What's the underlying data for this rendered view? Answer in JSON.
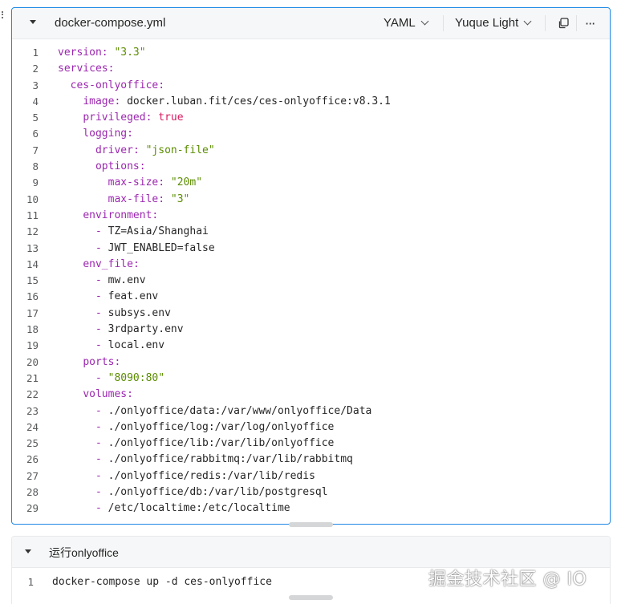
{
  "block1": {
    "filename": "docker-compose.yml",
    "language": "YAML",
    "theme": "Yuque Light",
    "copy_icon": "copy-icon",
    "more_icon": "more-icon",
    "lines": [
      {
        "n": "1",
        "indent": "",
        "key": "version",
        "sep": ": ",
        "val": "\"3.3\"",
        "vt": "s"
      },
      {
        "n": "2",
        "indent": "",
        "key": "services",
        "sep": ":",
        "val": "",
        "vt": ""
      },
      {
        "n": "3",
        "indent": "  ",
        "key": "ces-onlyoffice",
        "sep": ":",
        "val": "",
        "vt": ""
      },
      {
        "n": "4",
        "indent": "    ",
        "key": "image",
        "sep": ": ",
        "val": "docker.luban.fit/ces/ces-onlyoffice:v8.3.1",
        "vt": "p"
      },
      {
        "n": "5",
        "indent": "    ",
        "key": "privileged",
        "sep": ": ",
        "val": "true",
        "vt": "b"
      },
      {
        "n": "6",
        "indent": "    ",
        "key": "logging",
        "sep": ":",
        "val": "",
        "vt": ""
      },
      {
        "n": "7",
        "indent": "      ",
        "key": "driver",
        "sep": ": ",
        "val": "\"json-file\"",
        "vt": "s"
      },
      {
        "n": "8",
        "indent": "      ",
        "key": "options",
        "sep": ":",
        "val": "",
        "vt": ""
      },
      {
        "n": "9",
        "indent": "        ",
        "key": "max-size",
        "sep": ": ",
        "val": "\"20m\"",
        "vt": "s"
      },
      {
        "n": "10",
        "indent": "        ",
        "key": "max-file",
        "sep": ": ",
        "val": "\"3\"",
        "vt": "s"
      },
      {
        "n": "11",
        "indent": "    ",
        "key": "environment",
        "sep": ":",
        "val": "",
        "vt": ""
      },
      {
        "n": "12",
        "indent": "      ",
        "key": "",
        "sep": "- ",
        "val": "TZ=Asia/Shanghai",
        "vt": "p"
      },
      {
        "n": "13",
        "indent": "      ",
        "key": "",
        "sep": "- ",
        "val": "JWT_ENABLED=false",
        "vt": "p"
      },
      {
        "n": "14",
        "indent": "    ",
        "key": "env_file",
        "sep": ":",
        "val": "",
        "vt": ""
      },
      {
        "n": "15",
        "indent": "      ",
        "key": "",
        "sep": "- ",
        "val": "mw.env",
        "vt": "p"
      },
      {
        "n": "16",
        "indent": "      ",
        "key": "",
        "sep": "- ",
        "val": "feat.env",
        "vt": "p"
      },
      {
        "n": "17",
        "indent": "      ",
        "key": "",
        "sep": "- ",
        "val": "subsys.env",
        "vt": "p"
      },
      {
        "n": "18",
        "indent": "      ",
        "key": "",
        "sep": "- ",
        "val": "3rdparty.env",
        "vt": "p"
      },
      {
        "n": "19",
        "indent": "      ",
        "key": "",
        "sep": "- ",
        "val": "local.env",
        "vt": "p"
      },
      {
        "n": "20",
        "indent": "    ",
        "key": "ports",
        "sep": ":",
        "val": "",
        "vt": ""
      },
      {
        "n": "21",
        "indent": "      ",
        "key": "",
        "sep": "- ",
        "val": "\"8090:80\"",
        "vt": "s"
      },
      {
        "n": "22",
        "indent": "    ",
        "key": "volumes",
        "sep": ":",
        "val": "",
        "vt": ""
      },
      {
        "n": "23",
        "indent": "      ",
        "key": "",
        "sep": "- ",
        "val": "./onlyoffice/data:/var/www/onlyoffice/Data",
        "vt": "p"
      },
      {
        "n": "24",
        "indent": "      ",
        "key": "",
        "sep": "- ",
        "val": "./onlyoffice/log:/var/log/onlyoffice",
        "vt": "p"
      },
      {
        "n": "25",
        "indent": "      ",
        "key": "",
        "sep": "- ",
        "val": "./onlyoffice/lib:/var/lib/onlyoffice",
        "vt": "p"
      },
      {
        "n": "26",
        "indent": "      ",
        "key": "",
        "sep": "- ",
        "val": "./onlyoffice/rabbitmq:/var/lib/rabbitmq",
        "vt": "p"
      },
      {
        "n": "27",
        "indent": "      ",
        "key": "",
        "sep": "- ",
        "val": "./onlyoffice/redis:/var/lib/redis",
        "vt": "p"
      },
      {
        "n": "28",
        "indent": "      ",
        "key": "",
        "sep": "- ",
        "val": "./onlyoffice/db:/var/lib/postgresql",
        "vt": "p"
      },
      {
        "n": "29",
        "indent": "      ",
        "key": "",
        "sep": "- ",
        "val": "/etc/localtime:/etc/localtime",
        "vt": "p"
      }
    ]
  },
  "block2": {
    "title": "运行onlyoffice",
    "lines": [
      {
        "n": "1",
        "text": "docker-compose up -d ces-onlyoffice"
      }
    ]
  },
  "watermark": "掘金技术社区 @ IO",
  "colors": {
    "key": "#9c27b0",
    "string": "#5b8c00",
    "boolean": "#d81b60",
    "active_border": "#1e88e5"
  }
}
